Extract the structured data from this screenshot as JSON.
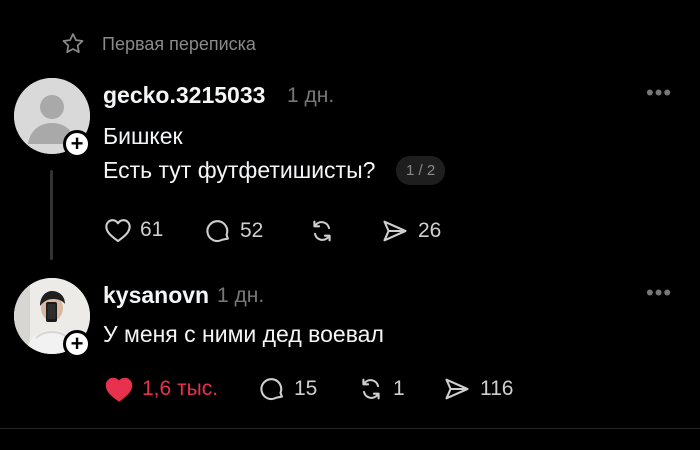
{
  "header": {
    "title": "Первая переписка",
    "icon": "star-icon"
  },
  "posts": [
    {
      "username": "gecko.3215033",
      "time": "1 дн.",
      "lines": [
        "Бишкек",
        "Есть тут футфетишисты?"
      ],
      "pager": "1 / 2",
      "likes": "61",
      "comments": "52",
      "reposts": "",
      "shares": "26",
      "liked": false
    },
    {
      "username": "kysanovn",
      "time": "1 дн.",
      "lines": [
        "У меня с ними дед воевал"
      ],
      "likes": "1,6 тыс.",
      "comments": "15",
      "reposts": "1",
      "shares": "116",
      "liked": true
    }
  ],
  "colors": {
    "background": "#000000",
    "text": "#f3f5f7",
    "muted": "#777777",
    "liked": "#e8314d"
  }
}
